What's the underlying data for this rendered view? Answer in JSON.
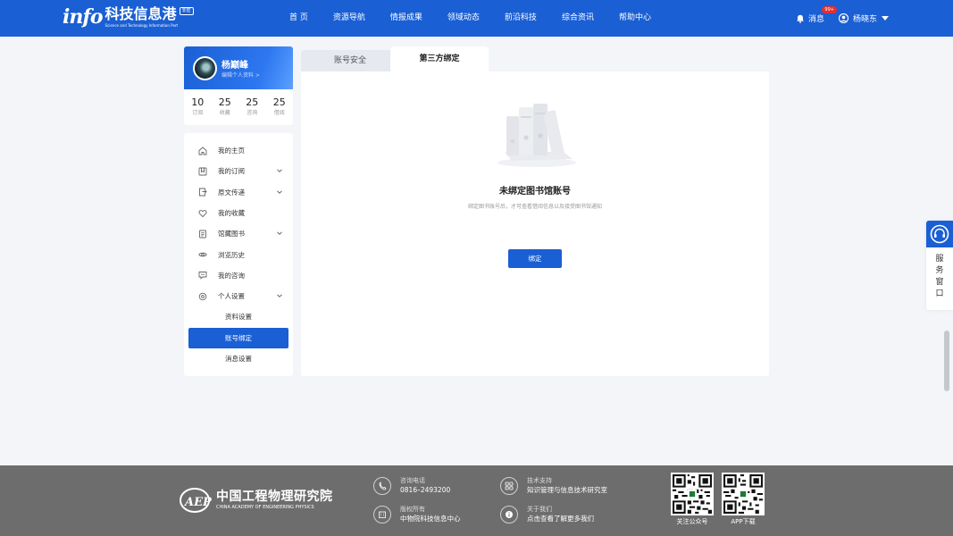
{
  "header": {
    "logo_mark": "info",
    "logo_title": "科技信息港",
    "logo_badge": "非密",
    "logo_subtitle": "Science and Technology Information Port",
    "nav": [
      "首 页",
      "资源导航",
      "情报成果",
      "领域动态",
      "前沿科技",
      "综合资讯",
      "帮助中心"
    ],
    "messages_label": "消息",
    "messages_badge": "99+",
    "user_name": "杨晓东"
  },
  "profile": {
    "name": "杨巅峰",
    "edit_link": "编辑个人资料 >",
    "stats": [
      {
        "value": "10",
        "label": "订阅"
      },
      {
        "value": "25",
        "label": "收藏"
      },
      {
        "value": "25",
        "label": "咨询"
      },
      {
        "value": "25",
        "label": "借阅"
      }
    ]
  },
  "sidebar": {
    "items": [
      {
        "label": "我的主页",
        "icon": "home-icon",
        "chevron": false
      },
      {
        "label": "我的订阅",
        "icon": "bookmark-icon",
        "chevron": true
      },
      {
        "label": "原文传递",
        "icon": "doc-transfer-icon",
        "chevron": true
      },
      {
        "label": "我的收藏",
        "icon": "heart-icon",
        "chevron": false
      },
      {
        "label": "馆藏图书",
        "icon": "book-icon",
        "chevron": true
      },
      {
        "label": "浏览历史",
        "icon": "eye-icon",
        "chevron": false
      },
      {
        "label": "我的咨询",
        "icon": "chat-icon",
        "chevron": false
      },
      {
        "label": "个人设置",
        "icon": "settings-icon",
        "chevron": true
      }
    ],
    "sub_items": [
      "资料设置",
      "账号绑定",
      "消息设置"
    ],
    "active_sub": "账号绑定"
  },
  "tabs": {
    "inactive": "账号安全",
    "active": "第三方绑定"
  },
  "empty_state": {
    "title": "未绑定图书馆账号",
    "description": "绑定图书账号后，才可查看借阅信息以及接受图书馆通知",
    "button": "绑定"
  },
  "service": {
    "label_chars": [
      "服",
      "务",
      "窗",
      "口"
    ]
  },
  "footer": {
    "org_cn": "中国工程物理研究院",
    "org_en": "CHINA ACADEMY OF ENGINEERING PHYSICS",
    "phone_label": "咨询电话",
    "phone_value": "0816–2493200",
    "support_label": "技术支持",
    "support_value": "知识管理与信息技术研究室",
    "copyright_label": "版权所有",
    "copyright_value": "中物院科技信息中心",
    "about_label": "关于我们",
    "about_value": "点击查看了解更多我们",
    "qr1_label": "关注公众号",
    "qr2_label": "APP下载"
  },
  "colors": {
    "primary": "#1a5fd4",
    "footer_bg": "#6d6d6d",
    "page_bg": "#f4f5f8",
    "badge": "#e62f2f"
  }
}
